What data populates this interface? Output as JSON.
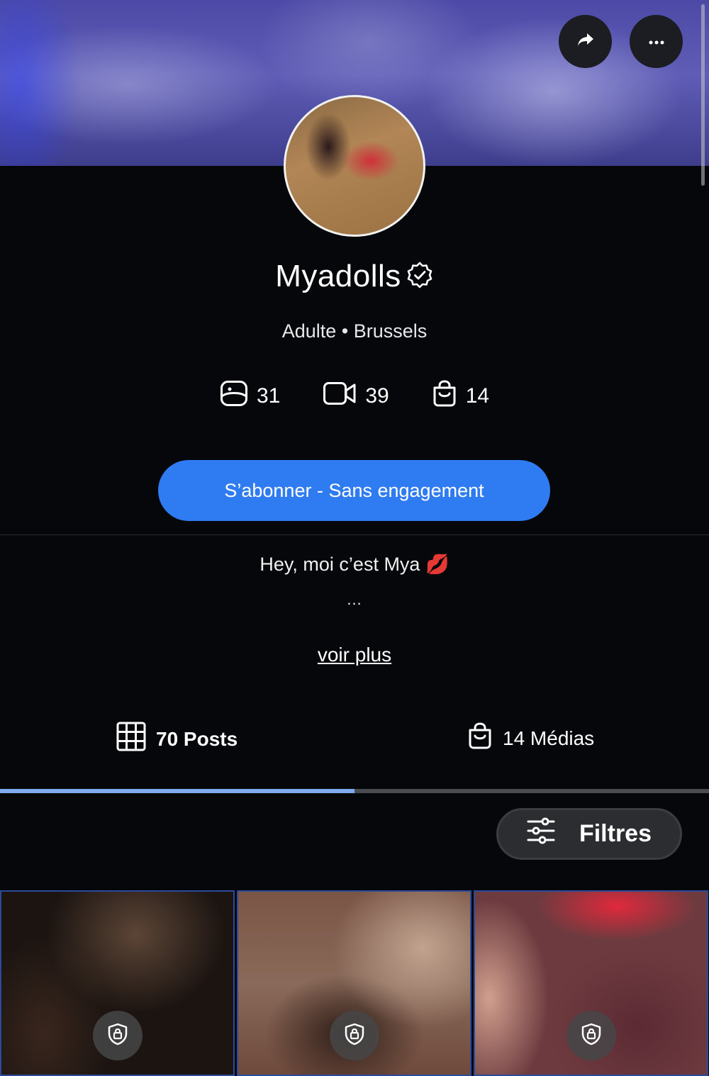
{
  "profile": {
    "name": "Myadolls",
    "category": "Adulte",
    "separator": "•",
    "location": "Brussels",
    "stats": {
      "photos": "31",
      "videos": "39",
      "medias": "14"
    }
  },
  "actions": {
    "subscribe_label": "S’abonner - Sans engagement"
  },
  "bio": {
    "text": "Hey, moi c’est Mya 💋",
    "ellipsis": "...",
    "see_more": "voir plus"
  },
  "tabs": {
    "posts_label": "70 Posts",
    "medias_label": "14 Médias",
    "active": "posts"
  },
  "filters": {
    "label": "Filtres"
  },
  "posts": [
    {
      "locked": true
    },
    {
      "locked": true
    },
    {
      "locked": true
    }
  ],
  "icons": {
    "share": "share-arrow-icon",
    "more": "more-dots-icon",
    "verified": "verified-badge-icon",
    "photos": "image-icon",
    "videos": "video-camera-icon",
    "medias": "shopping-bag-icon",
    "grid": "grid-icon",
    "filters": "sliders-icon",
    "lock": "lock-shield-icon"
  },
  "colors": {
    "background": "#05070b",
    "accent": "#2f7bf2",
    "tab_indicator": "#7faaf2"
  }
}
